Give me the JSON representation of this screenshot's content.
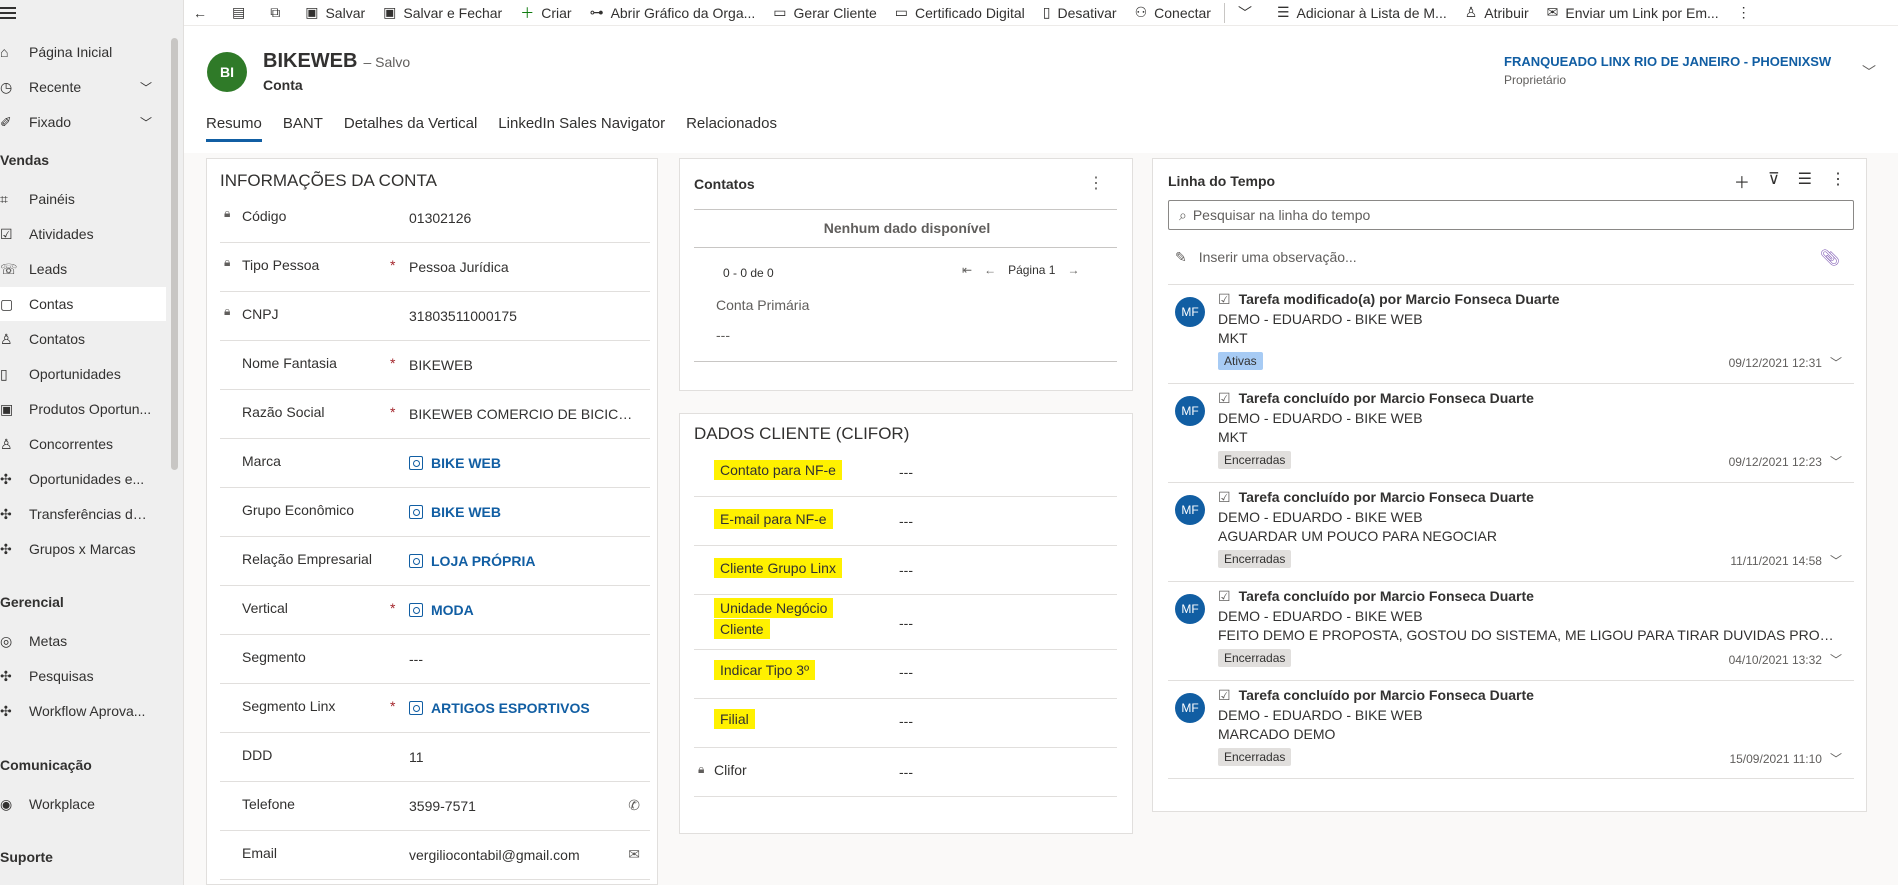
{
  "sidebar": {
    "items": [
      {
        "label": "Página Inicial",
        "icon": "home-icon"
      },
      {
        "label": "Recente",
        "icon": "clock-icon"
      },
      {
        "label": "Fixado",
        "icon": "pin-icon"
      },
      {
        "label": "Painéis",
        "icon": "dashboard-icon"
      },
      {
        "label": "Atividades",
        "icon": "activities-icon"
      },
      {
        "label": "Leads",
        "icon": "leads-icon"
      },
      {
        "label": "Contas",
        "icon": "accounts-icon"
      },
      {
        "label": "Contatos",
        "icon": "person-icon"
      },
      {
        "label": "Oportunidades",
        "icon": "opportunity-icon"
      },
      {
        "label": "Produtos Oportun...",
        "icon": "product-icon"
      },
      {
        "label": "Concorrentes",
        "icon": "competitor-icon"
      },
      {
        "label": "Oportunidades e...",
        "icon": "puzzle-icon"
      },
      {
        "label": "Transferências de ...",
        "icon": "puzzle-icon"
      },
      {
        "label": "Grupos x Marcas",
        "icon": "puzzle-icon"
      },
      {
        "label": "Metas",
        "icon": "target-icon"
      },
      {
        "label": "Pesquisas",
        "icon": "puzzle-icon"
      },
      {
        "label": "Workflow Aprova...",
        "icon": "puzzle-icon"
      },
      {
        "label": "Workplace",
        "icon": "workplace-icon"
      }
    ],
    "groups": {
      "vendas": "Vendas",
      "gerencial": "Gerencial",
      "comunicacao": "Comunicação",
      "suporte": "Suporte"
    }
  },
  "toolbar": {
    "salvar": "Salvar",
    "salvar_fechar": "Salvar e Fechar",
    "criar": "Criar",
    "abrir_grafico": "Abrir Gráfico da Orga...",
    "gerar_cliente": "Gerar Cliente",
    "certificado": "Certificado Digital",
    "desativar": "Desativar",
    "conectar": "Conectar",
    "adicionar_lista": "Adicionar à Lista de M...",
    "atribuir": "Atribuir",
    "enviar_link": "Enviar um Link por Em..."
  },
  "header": {
    "initials": "BI",
    "title": "BIKEWEB",
    "saved": "– Salvo",
    "type": "Conta",
    "owner": "FRANQUEADO LINX RIO DE JANEIRO - PHOENIXSW",
    "owner_label": "Proprietário"
  },
  "tabs": [
    "Resumo",
    "BANT",
    "Detalhes da Vertical",
    "LinkedIn Sales Navigator",
    "Relacionados"
  ],
  "conta": {
    "title": "INFORMAÇÕES DA CONTA",
    "fields": [
      {
        "label": "Código",
        "value": "01302126"
      },
      {
        "label": "Tipo Pessoa",
        "value": "Pessoa Jurídica"
      },
      {
        "label": "CNPJ",
        "value": "31803511000175"
      },
      {
        "label": "Nome Fantasia",
        "value": "BIKEWEB"
      },
      {
        "label": "Razão Social",
        "value": "BIKEWEB COMERCIO DE BICICLETA..."
      },
      {
        "label": "Marca",
        "value": "BIKE WEB"
      },
      {
        "label": "Grupo Econômico",
        "value": "BIKE WEB"
      },
      {
        "label": "Relação Empresarial",
        "value": "LOJA PRÓPRIA"
      },
      {
        "label": "Vertical",
        "value": "MODA"
      },
      {
        "label": "Segmento",
        "value": "---"
      },
      {
        "label": "Segmento Linx",
        "value": "ARTIGOS ESPORTIVOS"
      },
      {
        "label": "DDD",
        "value": "11"
      },
      {
        "label": "Telefone",
        "value": "3599-7571"
      },
      {
        "label": "Email",
        "value": "vergiliocontabil@gmail.com"
      }
    ],
    "required_mark": "*"
  },
  "contatos": {
    "title": "Contatos",
    "empty": "Nenhum dado disponível",
    "count": "0 - 0 de 0",
    "page": "Página 1",
    "conta_primaria_label": "Conta Primária",
    "conta_primaria_value": "---"
  },
  "clifor": {
    "title": "DADOS CLIENTE (CLIFOR)",
    "fields": [
      {
        "label": "Contato para NF-e",
        "value": "---"
      },
      {
        "label": "E-mail para NF-e",
        "value": "---"
      },
      {
        "label": "Cliente Grupo Linx",
        "value": "---"
      },
      {
        "label": "Unidade Negócio",
        "label2": "Cliente",
        "value": "---"
      },
      {
        "label": "Indicar Tipo 3º",
        "value": "---"
      },
      {
        "label": "Filial",
        "value": "---"
      },
      {
        "label": "Clifor",
        "value": "---"
      }
    ]
  },
  "timeline": {
    "title": "Linha do Tempo",
    "search_placeholder": "Pesquisar na linha do tempo",
    "note_placeholder": "Inserir uma observação...",
    "items": [
      {
        "initials": "MF",
        "head": "Tarefa modificado(a) por Marcio Fonseca Duarte",
        "l2": "DEMO - EDUARDO - BIKE WEB",
        "l3": "MKT",
        "badge": "Ativas",
        "date": "09/12/2021 12:31"
      },
      {
        "initials": "MF",
        "head": "Tarefa concluído por Marcio Fonseca Duarte",
        "l2": "DEMO - EDUARDO - BIKE WEB",
        "l3": "MKT",
        "badge": "Encerradas",
        "date": "09/12/2021 12:23"
      },
      {
        "initials": "MF",
        "head": "Tarefa concluído por Marcio Fonseca Duarte",
        "l2": "DEMO - EDUARDO - BIKE WEB",
        "l3": "AGUARDAR UM POUCO PARA NEGOCIAR",
        "badge": "Encerradas",
        "date": "11/11/2021 14:58"
      },
      {
        "initials": "MF",
        "head": "Tarefa concluído por Marcio Fonseca Duarte",
        "l2": "DEMO - EDUARDO - BIKE WEB",
        "l3": "FEITO DEMO E PROPOSTA, GOSTOU DO SISTEMA, ME LIGOU PARA TIRAR DUVIDAS PROPOSTAS , ...",
        "badge": "Encerradas",
        "date": "04/10/2021 13:32"
      },
      {
        "initials": "MF",
        "head": "Tarefa concluído por Marcio Fonseca Duarte",
        "l2": "DEMO - EDUARDO - BIKE WEB",
        "l3": "MARCADO DEMO",
        "badge": "Encerradas",
        "date": "15/09/2021 11:10"
      }
    ]
  },
  "colors": {
    "accent": "#115ea3",
    "avatar_green": "#2f7a28",
    "highlight": "#fff100"
  }
}
